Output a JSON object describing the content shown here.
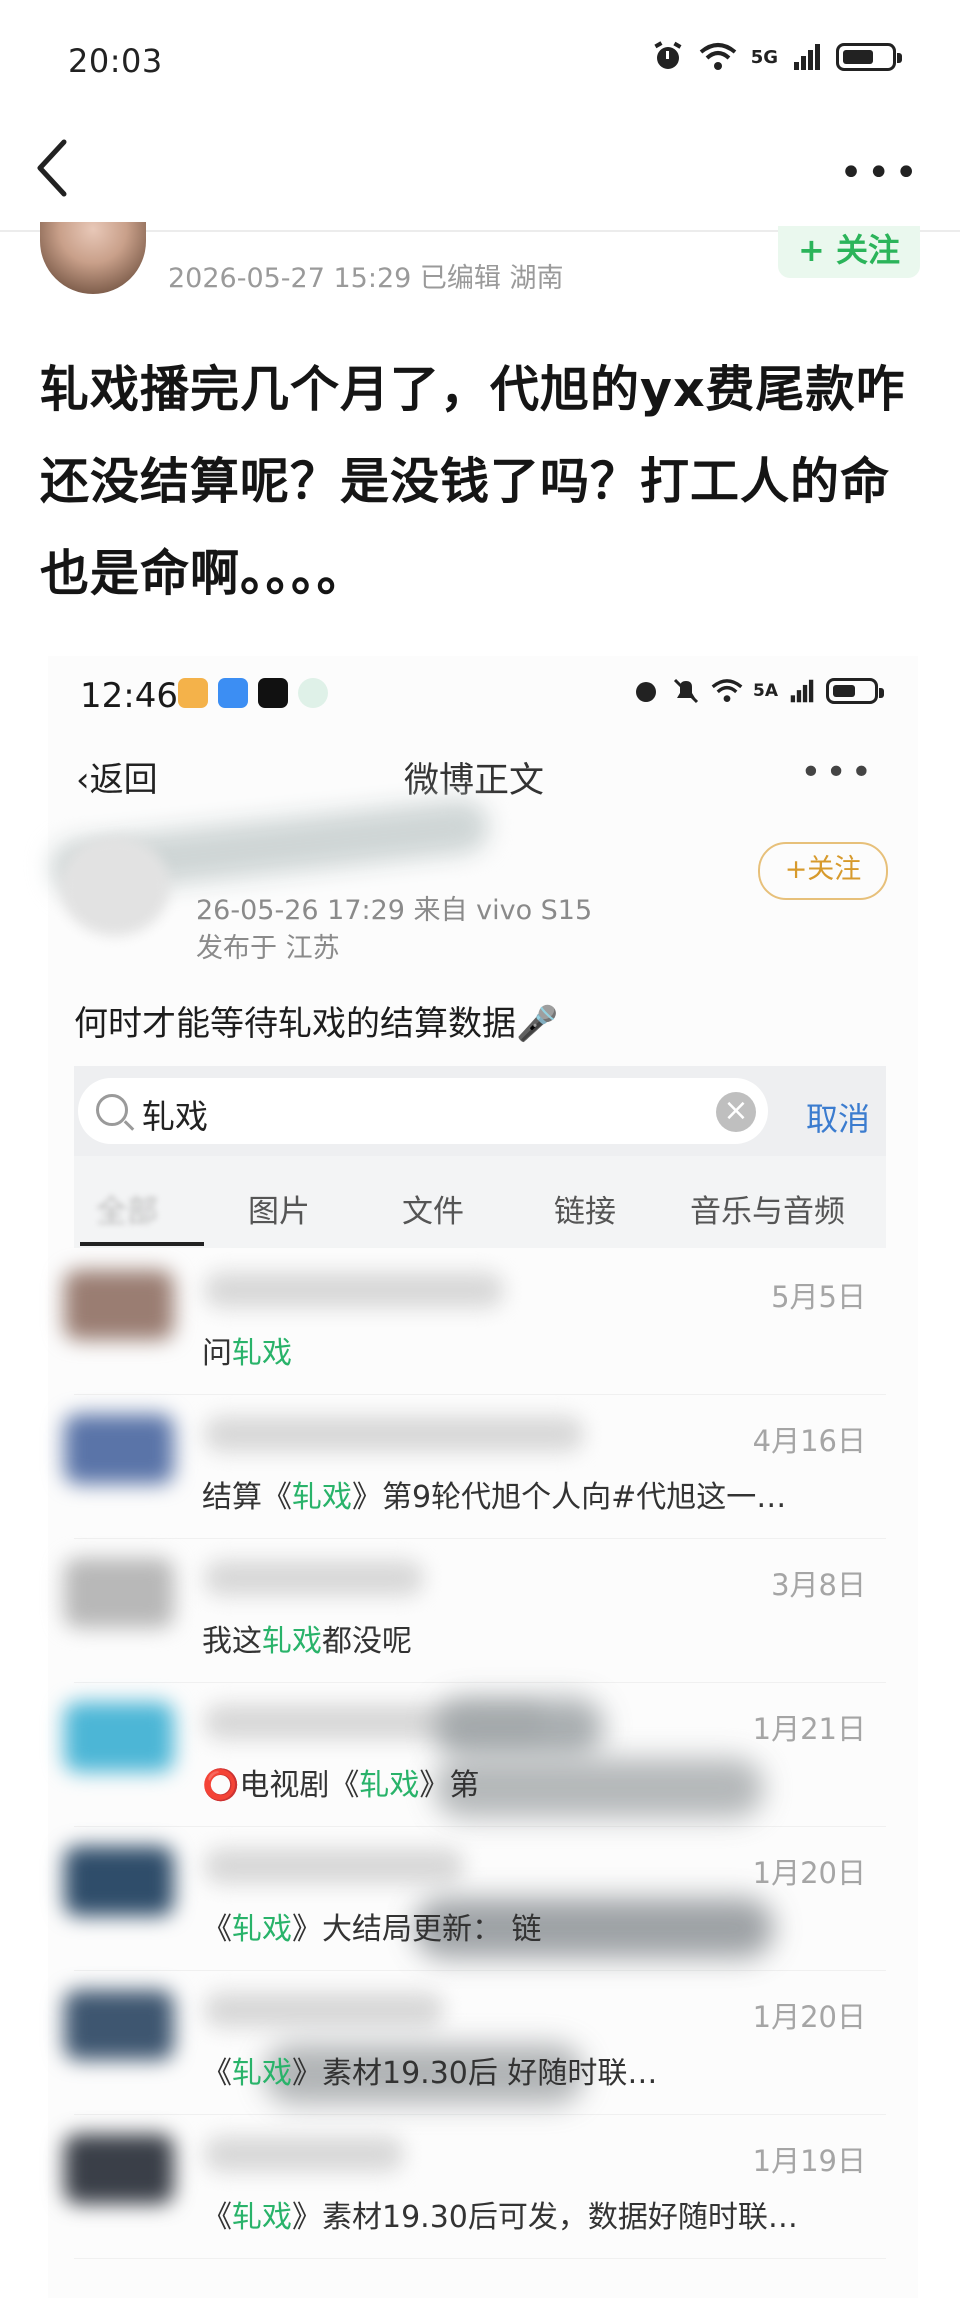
{
  "status_bar": {
    "time": "20:03",
    "network": "5G"
  },
  "post": {
    "meta": "2026-05-27 15:29  已编辑  湖南",
    "follow_label": "+ 关注",
    "text": "轧戏播完几个月了，代旭的yx费尾款咋还没结算呢？是没钱了吗？打工人的命也是命啊。。。。"
  },
  "embedded": {
    "status": {
      "time": "12:46",
      "network": "5A"
    },
    "nav": {
      "back_label": "返回",
      "title": "微博正文"
    },
    "post": {
      "date_line": "26-05-26 17:29  来自 vivo S15",
      "location_line": "发布于 江苏",
      "follow_label": "+关注",
      "question": "何时才能等待轧戏的结算数据"
    },
    "search": {
      "value": "轧戏",
      "cancel_label": "取消"
    },
    "tabs": [
      "全部",
      "图片",
      "文件",
      "链接",
      "音乐与音频"
    ],
    "results": [
      {
        "date": "5月5日",
        "prefix": "问",
        "keyword": "轧戏",
        "suffix": ""
      },
      {
        "date": "4月16日",
        "prefix": "结算《",
        "keyword": "轧戏",
        "suffix": "》第9轮代旭个人向#代旭这一…"
      },
      {
        "date": "3月8日",
        "prefix": "我这",
        "keyword": "轧戏",
        "suffix": "都没呢"
      },
      {
        "date": "1月21日",
        "prefix": "⭕电视剧《",
        "keyword": "轧戏",
        "suffix": "》第"
      },
      {
        "date": "1月20日",
        "prefix": "《",
        "keyword": "轧戏",
        "suffix": "》大结局更新：  链"
      },
      {
        "date": "1月20日",
        "prefix": "《",
        "keyword": "轧戏",
        "suffix": "》素材19.30后          好随时联…"
      },
      {
        "date": "1月19日",
        "prefix": "《",
        "keyword": "轧戏",
        "suffix": "》素材19.30后可发，数据好随时联…"
      }
    ]
  },
  "colors": {
    "accent_green": "#2bb45a",
    "link_blue": "#3b7ccf",
    "follow_gold": "#d79a2c"
  }
}
